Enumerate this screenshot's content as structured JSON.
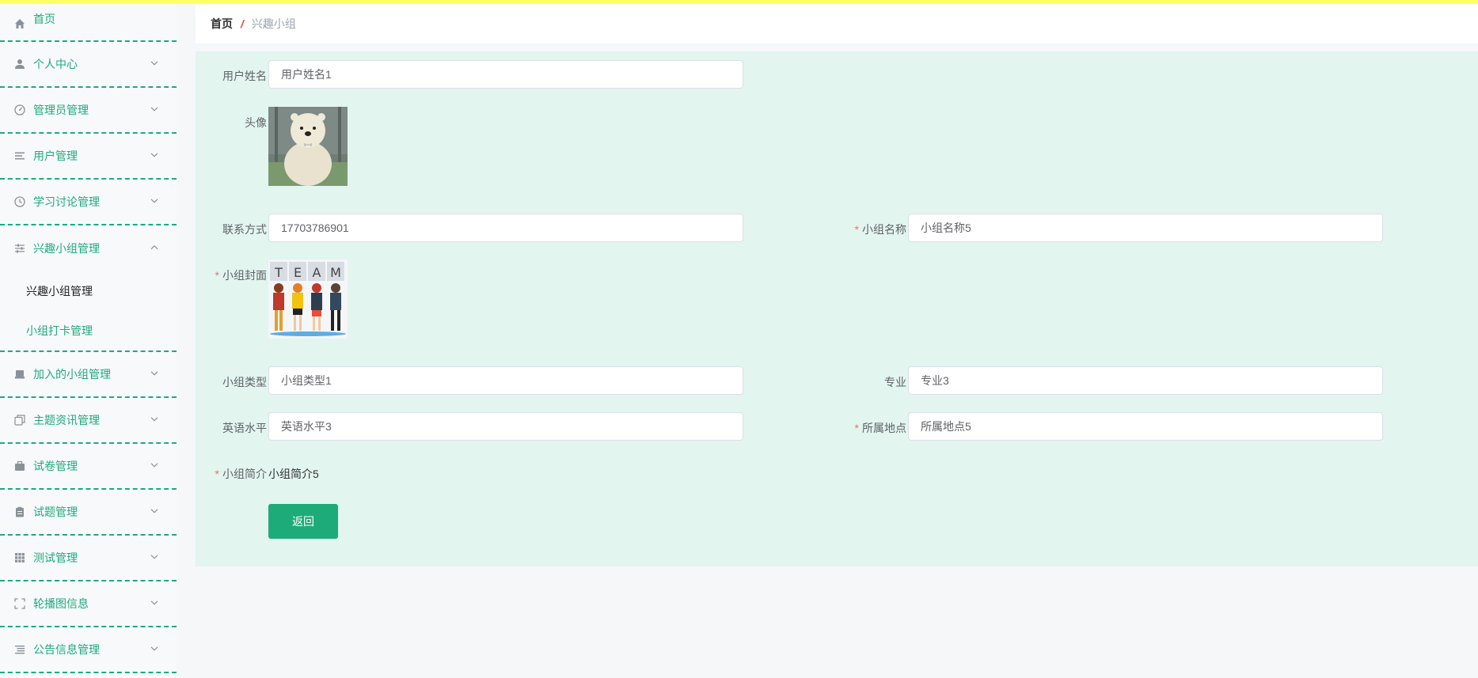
{
  "breadcrumb": {
    "home": "首页",
    "separator": "/",
    "current": "兴趣小组"
  },
  "sidebar": {
    "home": "首页",
    "items": [
      {
        "label": "个人中心",
        "icon": "user-icon"
      },
      {
        "label": "管理员管理",
        "icon": "dashboard-icon"
      },
      {
        "label": "用户管理",
        "icon": "list-icon"
      },
      {
        "label": "学习讨论管理",
        "icon": "clock-icon"
      },
      {
        "label": "兴趣小组管理",
        "icon": "sliders-icon",
        "expanded": true,
        "children": [
          {
            "label": "兴趣小组管理",
            "active": true
          },
          {
            "label": "小组打卡管理",
            "active": false
          }
        ]
      },
      {
        "label": "加入的小组管理",
        "icon": "inbox-icon"
      },
      {
        "label": "主题资讯管理",
        "icon": "copy-icon"
      },
      {
        "label": "试卷管理",
        "icon": "briefcase-icon"
      },
      {
        "label": "试题管理",
        "icon": "clipboard-icon"
      },
      {
        "label": "测试管理",
        "icon": "grid-icon"
      },
      {
        "label": "轮播图信息",
        "icon": "fullscreen-icon"
      },
      {
        "label": "公告信息管理",
        "icon": "menu-icon"
      }
    ]
  },
  "form": {
    "username": {
      "label": "用户姓名",
      "value": "用户姓名1"
    },
    "avatar": {
      "label": "头像"
    },
    "contact": {
      "label": "联系方式",
      "value": "17703786901"
    },
    "group_name": {
      "label": "小组名称",
      "value": "小组名称5",
      "required": "*"
    },
    "cover": {
      "label": "小组封面",
      "required": "*",
      "letters": [
        "T",
        "E",
        "A",
        "M"
      ]
    },
    "group_type": {
      "label": "小组类型",
      "value": "小组类型1"
    },
    "major": {
      "label": "专业",
      "value": "专业3"
    },
    "english": {
      "label": "英语水平",
      "value": "英语水平3"
    },
    "location": {
      "label": "所属地点",
      "value": "所属地点5",
      "required": "*"
    },
    "intro": {
      "label": "小组简介",
      "value": "小组简介5",
      "required": "*"
    },
    "back_button": "返回"
  },
  "colors": {
    "accent": "#1eab7a",
    "panel_bg": "#e2f5ef",
    "top_strip": "#ffff66",
    "required": "#f56c6c",
    "separator": "#e74c3c"
  }
}
